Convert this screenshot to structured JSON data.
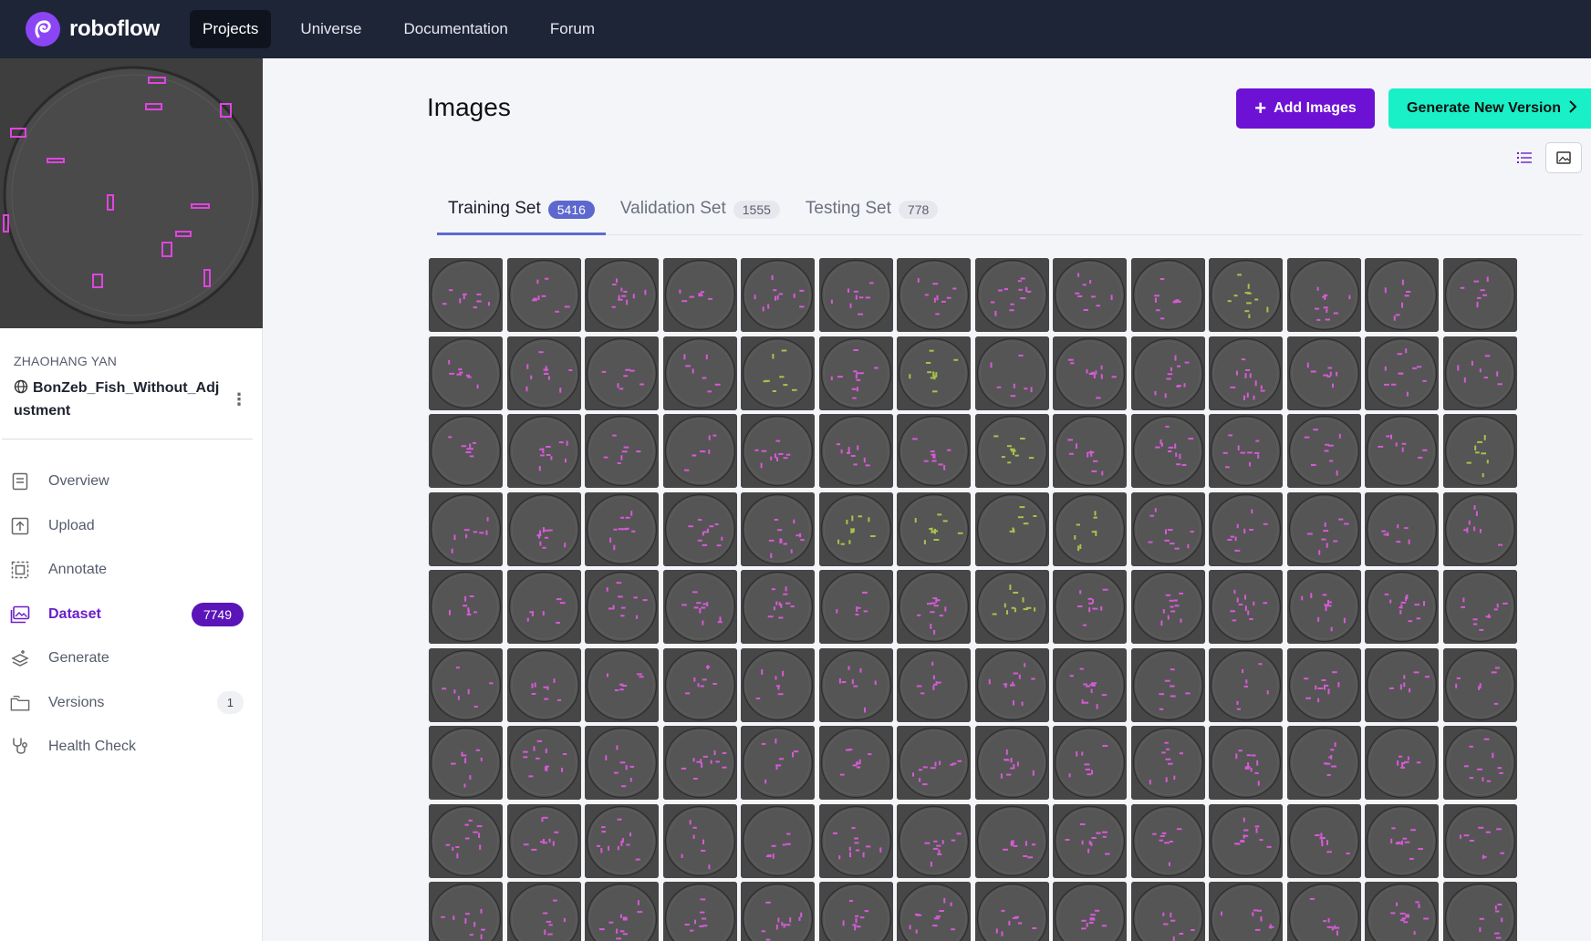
{
  "brand": {
    "name": "roboflow"
  },
  "nav": [
    {
      "label": "Projects",
      "active": true
    },
    {
      "label": "Universe",
      "active": false
    },
    {
      "label": "Documentation",
      "active": false
    },
    {
      "label": "Forum",
      "active": false
    }
  ],
  "project": {
    "owner": "ZHAOHANG YAN",
    "name": "BonZeb_Fish_Without_Adjustment",
    "visibility_icon": "globe-icon"
  },
  "sidebar": [
    {
      "label": "Overview",
      "icon": "overview-icon"
    },
    {
      "label": "Upload",
      "icon": "upload-icon"
    },
    {
      "label": "Annotate",
      "icon": "annotate-icon"
    },
    {
      "label": "Dataset",
      "icon": "dataset-icon",
      "badge": "7749",
      "active": true
    },
    {
      "label": "Generate",
      "icon": "generate-icon"
    },
    {
      "label": "Versions",
      "icon": "versions-icon",
      "badge": "1"
    },
    {
      "label": "Health Check",
      "icon": "health-check-icon"
    }
  ],
  "page": {
    "title": "Images",
    "add_button": "Add Images",
    "generate_button": "Generate New Version"
  },
  "tabs": [
    {
      "label": "Training Set",
      "count": "5416",
      "active": true
    },
    {
      "label": "Validation Set",
      "count": "1555",
      "active": false
    },
    {
      "label": "Testing Set",
      "count": "778",
      "active": false
    }
  ],
  "colors": {
    "nav_bg": "#1e2537",
    "accent_purple": "#6d12d4",
    "accent_teal": "#19f0c8",
    "tab_active": "#5d68cf",
    "annotation_magenta": "#d65ad6",
    "annotation_green": "#a7c34a"
  },
  "grid": {
    "columns": 14,
    "visible_rows": 9
  }
}
